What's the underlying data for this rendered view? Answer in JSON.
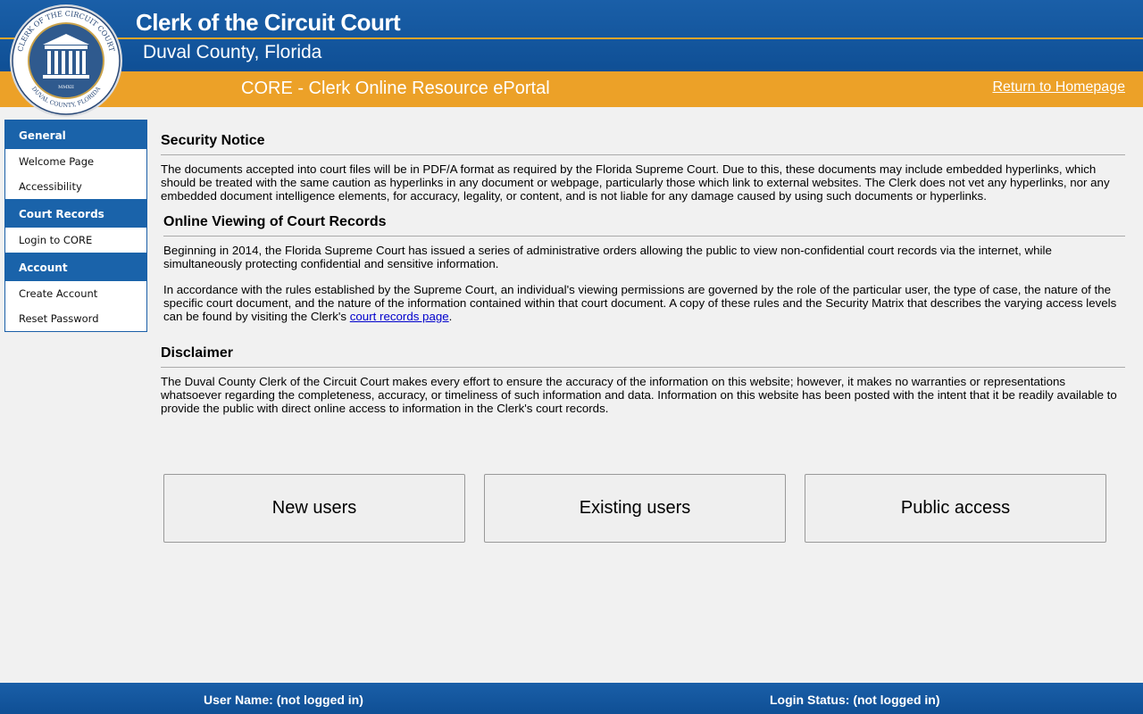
{
  "header": {
    "title": "Clerk of the Circuit Court",
    "subtitle": "Duval County, Florida",
    "portal": "CORE - Clerk Online Resource ePortal",
    "home_link": "Return to Homepage",
    "seal_text": [
      "CLERK OF THE CIRCUIT COURT",
      "DUVAL COUNTY, FLORIDA",
      "MMXII"
    ]
  },
  "sidebar": {
    "sections": [
      {
        "label": "General",
        "items": [
          "Welcome Page",
          "Accessibility"
        ]
      },
      {
        "label": "Court Records",
        "items": [
          "Login to CORE"
        ]
      },
      {
        "label": "Account",
        "items": [
          "Create Account",
          "Reset Password"
        ]
      }
    ]
  },
  "main": {
    "security": {
      "title": "Security Notice",
      "text": "The documents accepted into court files will be in PDF/A format as required by the Florida Supreme Court. Due to this, these documents may include embedded hyperlinks, which should be treated with the same caution as hyperlinks in any document or webpage, particularly those which link to external websites. The Clerk does not vet any hyperlinks, nor any embedded document intelligence elements, for accuracy, legality, or content, and is not liable for any damage caused by using such documents or hyperlinks."
    },
    "online": {
      "title": "Online Viewing of Court Records",
      "p1": "Beginning in 2014, the Florida Supreme Court has issued a series of administrative orders allowing the public to view non-confidential court records via the internet, while simultaneously protecting confidential and sensitive information.",
      "p2": "In accordance with the rules established by the Supreme Court, an individual's viewing permissions are governed by the role of the particular user, the type of case, the nature of the specific court document, and the nature of the information contained within that court document. A copy of these rules and the Security Matrix that describes the varying access levels can be found by visiting the Clerk's ",
      "link": "court records page",
      "end": "."
    },
    "disclaimer": {
      "title": "Disclaimer",
      "text": "The Duval County Clerk of the Circuit Court makes every effort to ensure the accuracy of the information on this website; however, it makes no warranties or representations whatsoever regarding the completeness, accuracy, or timeliness of such information and data. Information on this website has been posted with the intent that it be readily available to provide the public with direct online access to information in the Clerk's court records."
    },
    "buttons": [
      "New users",
      "Existing users",
      "Public access"
    ]
  },
  "footer": {
    "user": "User Name: (not logged in)",
    "status": "Login Status: (not logged in)"
  }
}
